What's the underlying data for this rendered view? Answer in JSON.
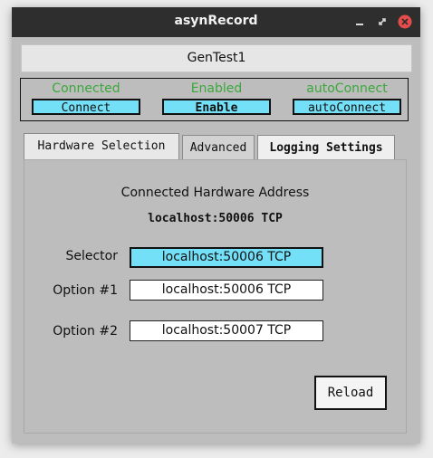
{
  "window": {
    "title": "asynRecord"
  },
  "device": {
    "name": "GenTest1"
  },
  "connection": {
    "connected_state": "Connected",
    "connect_label": "Connect",
    "enabled_state": "Enabled",
    "enable_label": "Enable",
    "autoconnect_state": "autoConnect",
    "autoconnect_label": "autoConnect"
  },
  "tabs": [
    {
      "label": "Hardware Selection",
      "active": true
    },
    {
      "label": "Advanced",
      "active": false
    },
    {
      "label": "Logging Settings",
      "active": false
    }
  ],
  "hardware": {
    "caption": "Connected Hardware Address",
    "address": "localhost:50006 TCP",
    "selector_label": "Selector",
    "selector_value": "localhost:50006 TCP",
    "option1_label": "Option #1",
    "option1_value": "localhost:50006 TCP",
    "option2_label": "Option #2",
    "option2_value": "localhost:50007 TCP",
    "reload_label": "Reload"
  },
  "colors": {
    "status_text": "#3ba83b",
    "highlight": "#74e0f7",
    "titlebar": "#2e2e2e",
    "close_button": "#e74c4c"
  },
  "icons": [
    "minimize-icon",
    "restore-icon",
    "close-icon"
  ]
}
